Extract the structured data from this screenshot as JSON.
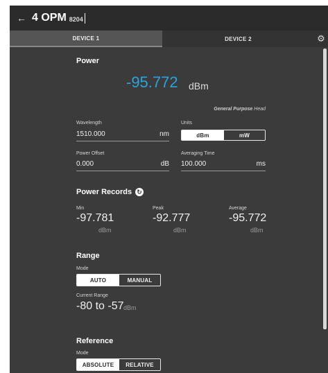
{
  "header": {
    "title": "4 OPM",
    "subtitle": "8204"
  },
  "tabs": [
    {
      "label": "DEVICE 1",
      "active": true
    },
    {
      "label": "DEVICE 2",
      "active": false
    }
  ],
  "power": {
    "section_title": "Power",
    "value": "-95.772",
    "unit": "dBm",
    "head_prefix": "General Purpose",
    "head_suffix": "Head",
    "wavelength": {
      "label": "Wavelength",
      "value": "1510.000",
      "unit": "nm"
    },
    "units": {
      "label": "Units",
      "options": [
        "dBm",
        "mW"
      ],
      "selected": "dBm"
    },
    "power_offset": {
      "label": "Power Offset",
      "value": "0.000",
      "unit": "dB"
    },
    "averaging_time": {
      "label": "Averaging Time",
      "value": "100.000",
      "unit": "ms"
    }
  },
  "power_records": {
    "section_title": "Power Records",
    "min": {
      "label": "Min",
      "value": "-97.781",
      "unit": "dBm"
    },
    "peak": {
      "label": "Peak",
      "value": "-92.777",
      "unit": "dBm"
    },
    "average": {
      "label": "Average",
      "value": "-95.772",
      "unit": "dBm"
    }
  },
  "range": {
    "section_title": "Range",
    "mode_label": "Mode",
    "options": [
      "AUTO",
      "MANUAL"
    ],
    "selected": "AUTO",
    "current_label": "Current Range",
    "current_value": "-80 to -57",
    "current_unit": "dBm"
  },
  "reference": {
    "section_title": "Reference",
    "mode_label": "Mode",
    "options": [
      "ABSOLUTE",
      "RELATIVE"
    ],
    "selected": "ABSOLUTE"
  },
  "icons": {
    "back": "arrow-left-icon",
    "settings": "gear-icon",
    "refresh": "refresh-icon"
  },
  "colors": {
    "accent": "#2aa4df",
    "panel_bg": "#3b3b3b",
    "titlebar_bg": "#2b2b2b"
  }
}
